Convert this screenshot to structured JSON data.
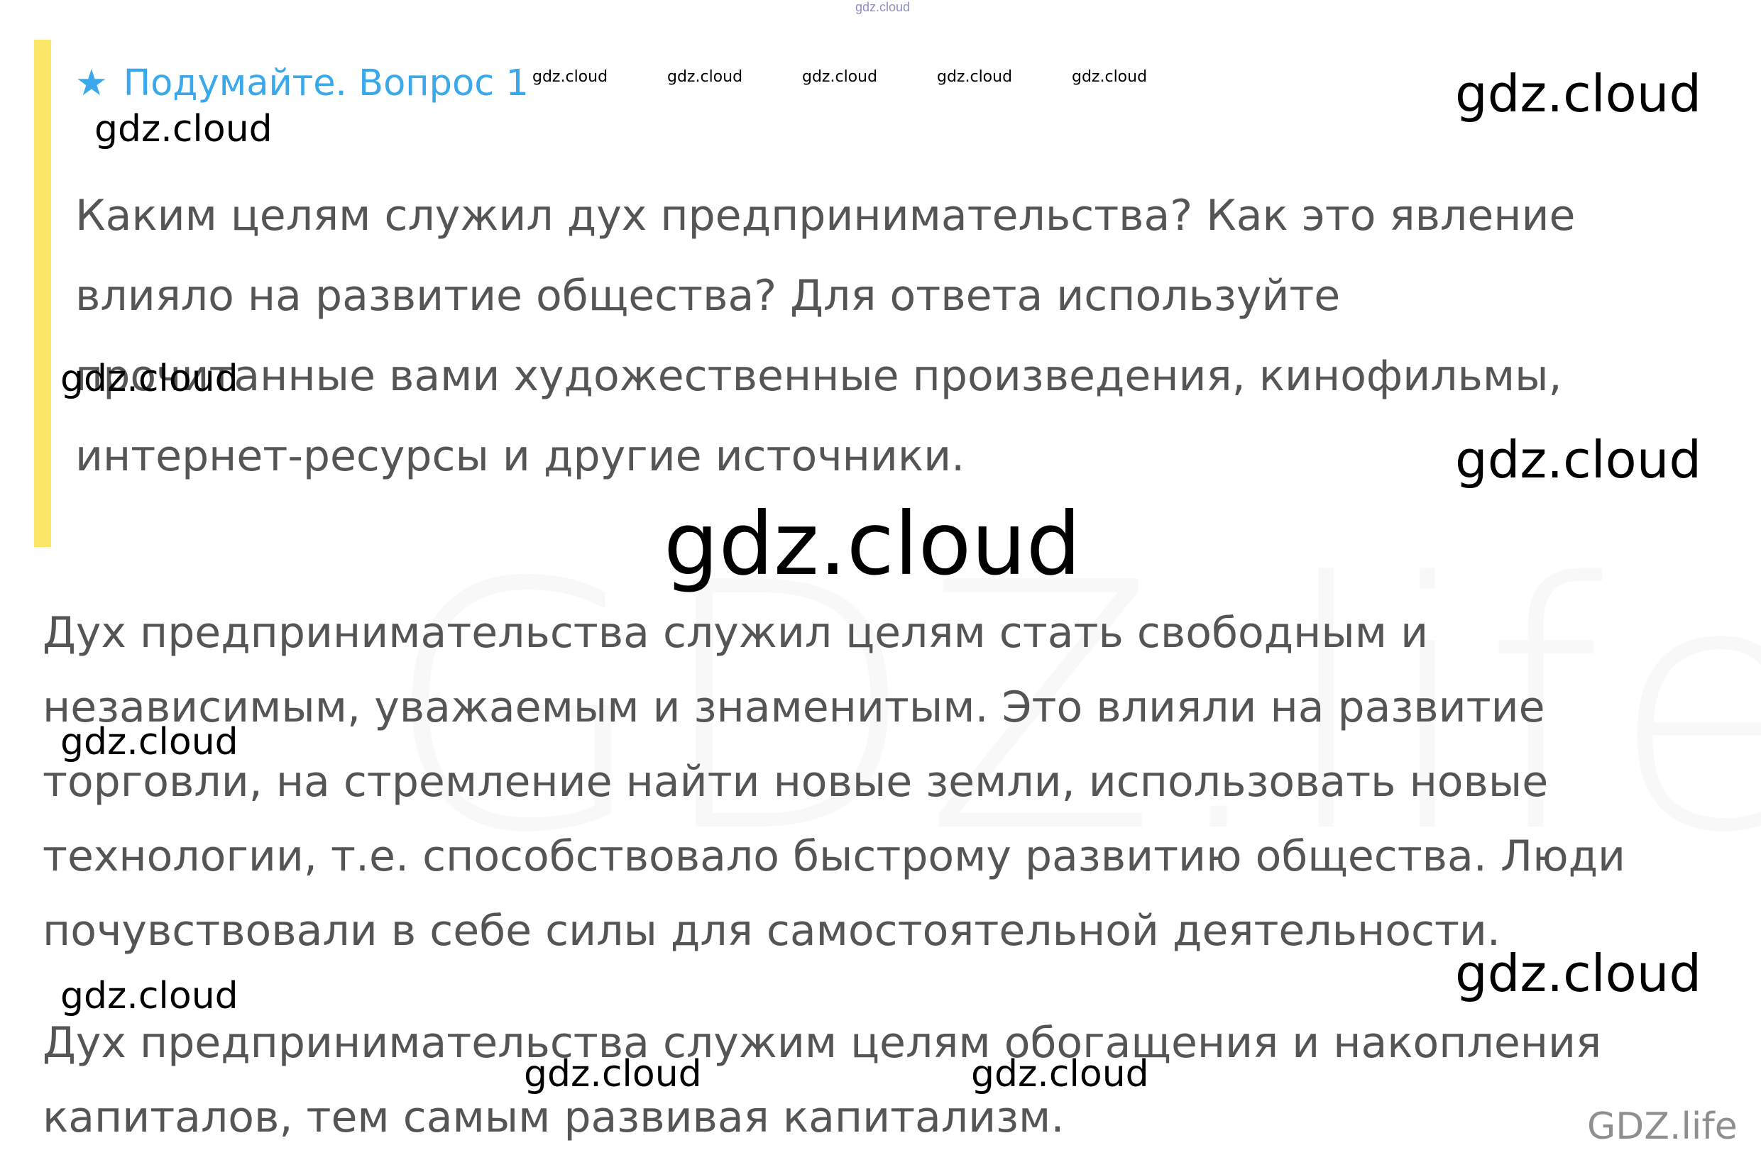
{
  "top_watermark": "gdz.cloud",
  "background_watermark": "GDZ.life",
  "question": {
    "star_icon": "★",
    "title": "Подумайте. Вопрос 1",
    "text": "Каким целям служил дух предпринимательства? Как это явление влияло на развитие общества? Для ответа используйте прочитанные вами художественные произведения, кинофильмы, интернет-ресурсы и другие источники.",
    "accent_color": "#fbe567",
    "title_color": "#39a9ec"
  },
  "answers": [
    "Дух предпринимательства служил целям стать свободным и независимым, уважаемым и знаменитым. Это влияли на развитие торговли, на стремление найти новые земли, использовать новые технологии, т.е. способствовало быстрому развитию общества. Люди почувствовали в себе силы для самостоятельной деятельности.",
    "Дух предпринимательства служим целям обогащения и накопления капиталов, тем самым развивая капитализм."
  ],
  "watermarks": {
    "small_row": [
      "gdz.cloud",
      "gdz.cloud",
      "gdz.cloud",
      "gdz.cloud",
      "gdz.cloud"
    ],
    "left": [
      "gdz.cloud",
      "gdz.cloud",
      "gdz.cloud",
      "gdz.cloud"
    ],
    "right": [
      "gdz.cloud",
      "gdz.cloud",
      "gdz.cloud"
    ],
    "center_big": "gdz.cloud",
    "bottom": [
      "gdz.cloud",
      "gdz.cloud"
    ]
  },
  "brand_footer": "GDZ.life"
}
